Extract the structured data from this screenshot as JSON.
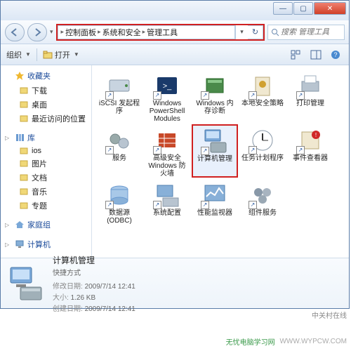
{
  "window": {
    "min": "—",
    "max": "▢",
    "close": "✕"
  },
  "breadcrumb": {
    "items": [
      "控制面板",
      "系统和安全",
      "管理工具"
    ]
  },
  "search": {
    "placeholder": "搜索 管理工具"
  },
  "toolbar": {
    "organize": "组织",
    "open": "打开"
  },
  "sidebar": {
    "groups": [
      {
        "expand": "",
        "icon": "star",
        "label": "收藏夹",
        "color": "#e8a030"
      },
      {
        "expand": "",
        "icon": "",
        "label": "下载",
        "indent": true
      },
      {
        "expand": "",
        "icon": "",
        "label": "桌面",
        "indent": true
      },
      {
        "expand": "",
        "icon": "",
        "label": "最近访问的位置",
        "indent": true
      },
      {
        "expand": "▷",
        "icon": "lib",
        "label": "库",
        "color": "#5a8ac8"
      },
      {
        "expand": "",
        "icon": "",
        "label": "ios",
        "indent": true
      },
      {
        "expand": "",
        "icon": "",
        "label": "图片",
        "indent": true
      },
      {
        "expand": "",
        "icon": "",
        "label": "文档",
        "indent": true
      },
      {
        "expand": "",
        "icon": "",
        "label": "音乐",
        "indent": true
      },
      {
        "expand": "",
        "icon": "",
        "label": "专题",
        "indent": true
      },
      {
        "expand": "▷",
        "icon": "home",
        "label": "家庭组",
        "color": "#5a8ac8"
      },
      {
        "expand": "▷",
        "icon": "pc",
        "label": "计算机",
        "color": "#5a8ac8"
      }
    ]
  },
  "items": [
    {
      "label": "iSCSI 发起程序",
      "icon": "drive"
    },
    {
      "label": "Windows PowerShell Modules",
      "icon": "ps"
    },
    {
      "label": "Windows 内存诊断",
      "icon": "mem"
    },
    {
      "label": "本地安全策略",
      "icon": "sec"
    },
    {
      "label": "打印管理",
      "icon": "print"
    },
    {
      "label": "服务",
      "icon": "gear"
    },
    {
      "label": "高级安全 Windows 防火墙",
      "icon": "fw"
    },
    {
      "label": "计算机管理",
      "icon": "compmgmt",
      "selected": true
    },
    {
      "label": "任务计划程序",
      "icon": "task"
    },
    {
      "label": "事件查看器",
      "icon": "event"
    },
    {
      "label": "数据源 (ODBC)",
      "icon": "odbc"
    },
    {
      "label": "系统配置",
      "icon": "sysconf"
    },
    {
      "label": "性能监视器",
      "icon": "perf"
    },
    {
      "label": "组件服务",
      "icon": "comp"
    }
  ],
  "details": {
    "title": "计算机管理",
    "subtitle": "快捷方式",
    "meta": [
      {
        "label": "修改日期:",
        "value": "2009/7/14 12:41"
      },
      {
        "label": "大小:",
        "value": "1.26 KB"
      },
      {
        "label": "创建日期:",
        "value": "2009/7/14 12:41"
      }
    ]
  },
  "watermarks": {
    "site": "中关村在线",
    "url": "无忧电脑学习网",
    "url2": "WWW.WYPCW.COM"
  }
}
